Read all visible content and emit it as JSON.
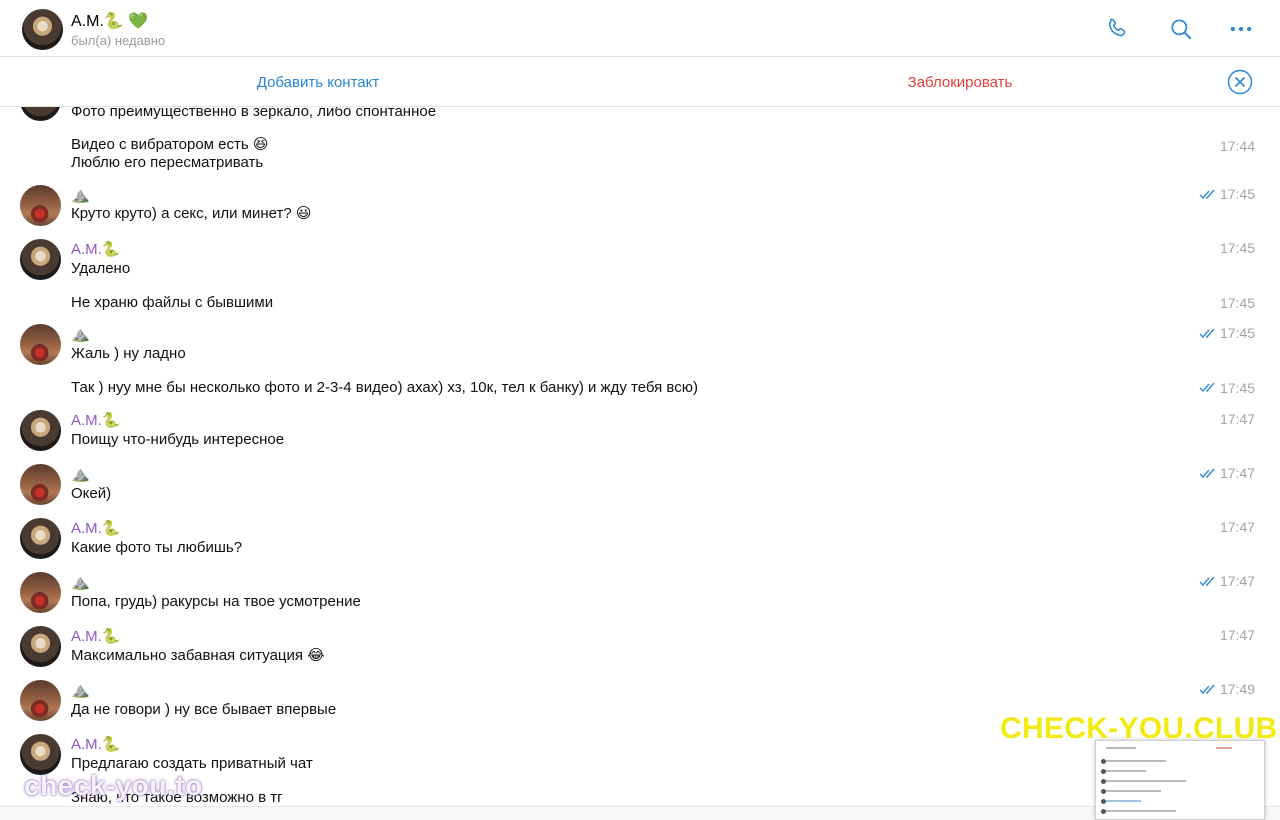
{
  "header": {
    "name": "А.М.🐍 💚",
    "status": "был(а) недавно",
    "call_icon": "phone-icon",
    "search_icon": "search-icon",
    "more_icon": "more-icon"
  },
  "actionbar": {
    "add_label": "Добавить контакт",
    "block_label": "Заблокировать",
    "close_icon": "close-circle-icon"
  },
  "messages": [
    {
      "sender": "",
      "text": "Фото преимущественно в зеркало, либо спонтанное",
      "time": "",
      "read": false
    },
    {
      "sender": "",
      "text": "Видео с вибратором есть 😆\nЛюблю его пересматривать",
      "time": "17:44",
      "read": false
    },
    {
      "sender": "⛰️",
      "text": "Круто круто) а секс, или минет? 😃",
      "time": "17:45",
      "read": true
    },
    {
      "sender": "А.М.🐍",
      "text": "Удалено",
      "time": "17:45",
      "read": false
    },
    {
      "sender": "",
      "text": "Не храню файлы с бывшими",
      "time": "17:45",
      "read": false
    },
    {
      "sender": "⛰️",
      "text": "Жаль ) ну ладно",
      "time": "17:45",
      "read": true
    },
    {
      "sender": "",
      "text": "Так ) нуу мне бы несколько фото и 2-3-4 видео) ахах) хз, 10к, тел к банку) и жду тебя всю)",
      "time": "17:45",
      "read": true
    },
    {
      "sender": "А.М.🐍",
      "text": "Поищу что-нибудь интересное",
      "time": "17:47",
      "read": false
    },
    {
      "sender": "⛰️",
      "text": "Окей)",
      "time": "17:47",
      "read": true
    },
    {
      "sender": "А.М.🐍",
      "text": "Какие фото ты любишь?",
      "time": "17:47",
      "read": false
    },
    {
      "sender": "⛰️",
      "text": "Попа, грудь) ракурсы на твое усмотрение",
      "time": "17:47",
      "read": true
    },
    {
      "sender": "А.М.🐍",
      "text": "Максимально забавная ситуация 😂",
      "time": "17:47",
      "read": false
    },
    {
      "sender": "⛰️",
      "text": "Да не говори ) ну все бывает впервые",
      "time": "17:49",
      "read": true
    },
    {
      "sender": "А.М.🐍",
      "text": "Предлагаю создать приватный чат",
      "time": "",
      "read": false
    },
    {
      "sender": "",
      "text": "Знаю, что такое возможно в тг",
      "time": "",
      "read": false
    }
  ],
  "watermarks": {
    "left": "check-you.to",
    "right": "CHECK-YOU.CLUB"
  },
  "colors": {
    "accent_blue": "#2a87d0",
    "block_red": "#e0403a",
    "sender_purple": "#8e56c8",
    "watermark_yellow": "#f2ea12"
  }
}
